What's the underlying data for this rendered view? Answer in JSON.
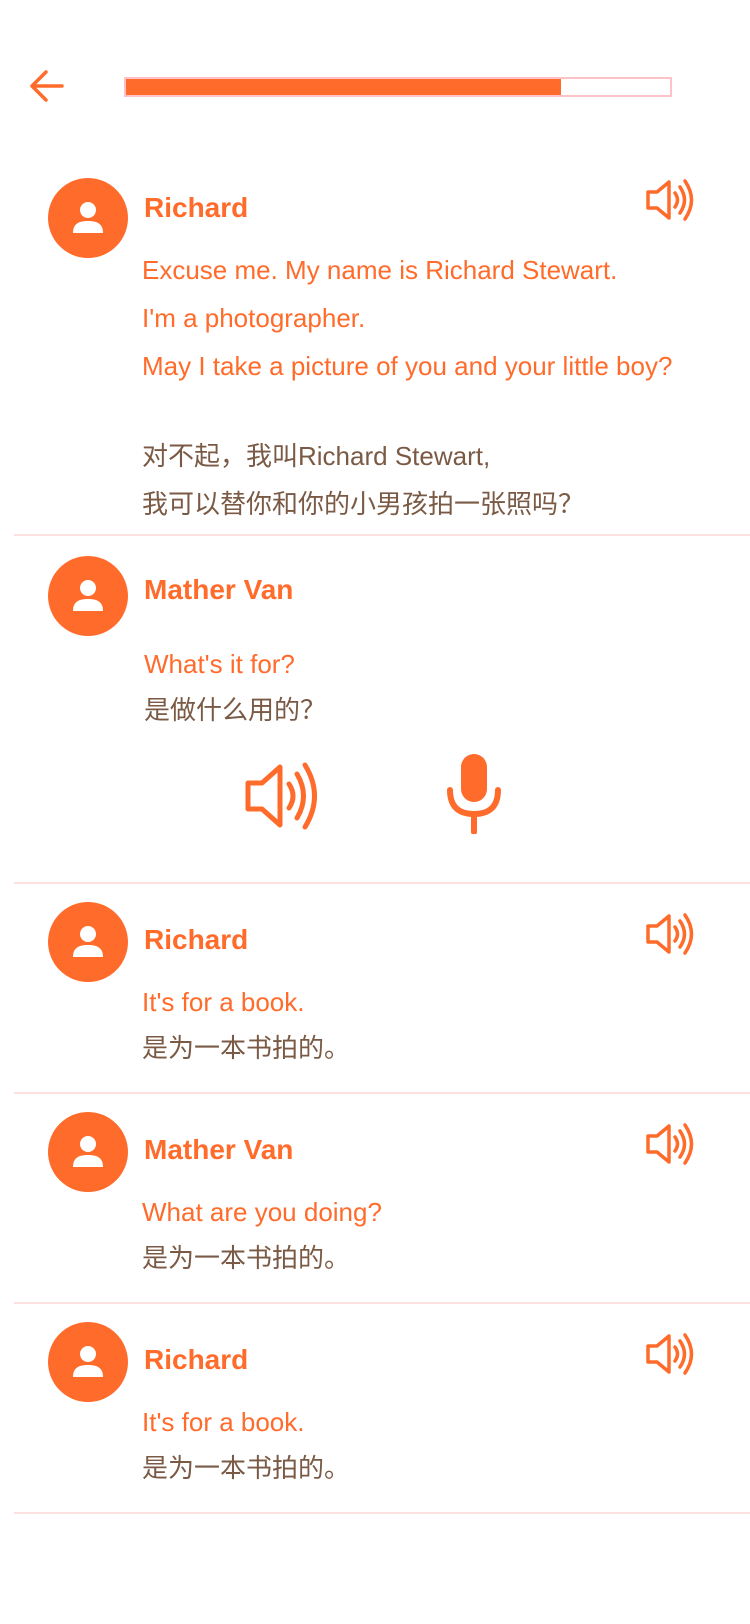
{
  "progress": {
    "fraction": 0.8
  },
  "accent_color": "#ff6b2b",
  "icons": {
    "back": "arrow-left-icon",
    "avatar": "person-icon",
    "play": "speaker-icon",
    "record": "microphone-icon"
  },
  "dialogue": [
    {
      "speaker": "Richard",
      "en_lines": [
        "Excuse me. My name is Richard Stewart.",
        "I'm a photographer.",
        "May I take a picture of you and your little boy?"
      ],
      "zh_lines": [
        "对不起，我叫Richard Stewart,",
        "我可以替你和你的小男孩拍一张照吗？"
      ]
    },
    {
      "speaker": "Mather Van",
      "en_lines": [
        "What's it for?"
      ],
      "zh_lines": [
        "是做什么用的？"
      ],
      "active": true
    },
    {
      "speaker": "Richard",
      "en_lines": [
        "It's for a book."
      ],
      "zh_lines": [
        "是为一本书拍的。"
      ]
    },
    {
      "speaker": "Mather Van",
      "en_lines": [
        "What are you doing?"
      ],
      "zh_lines": [
        "是为一本书拍的。"
      ]
    },
    {
      "speaker": "Richard",
      "en_lines": [
        "It's for a book."
      ],
      "zh_lines": [
        "是为一本书拍的。"
      ]
    }
  ]
}
